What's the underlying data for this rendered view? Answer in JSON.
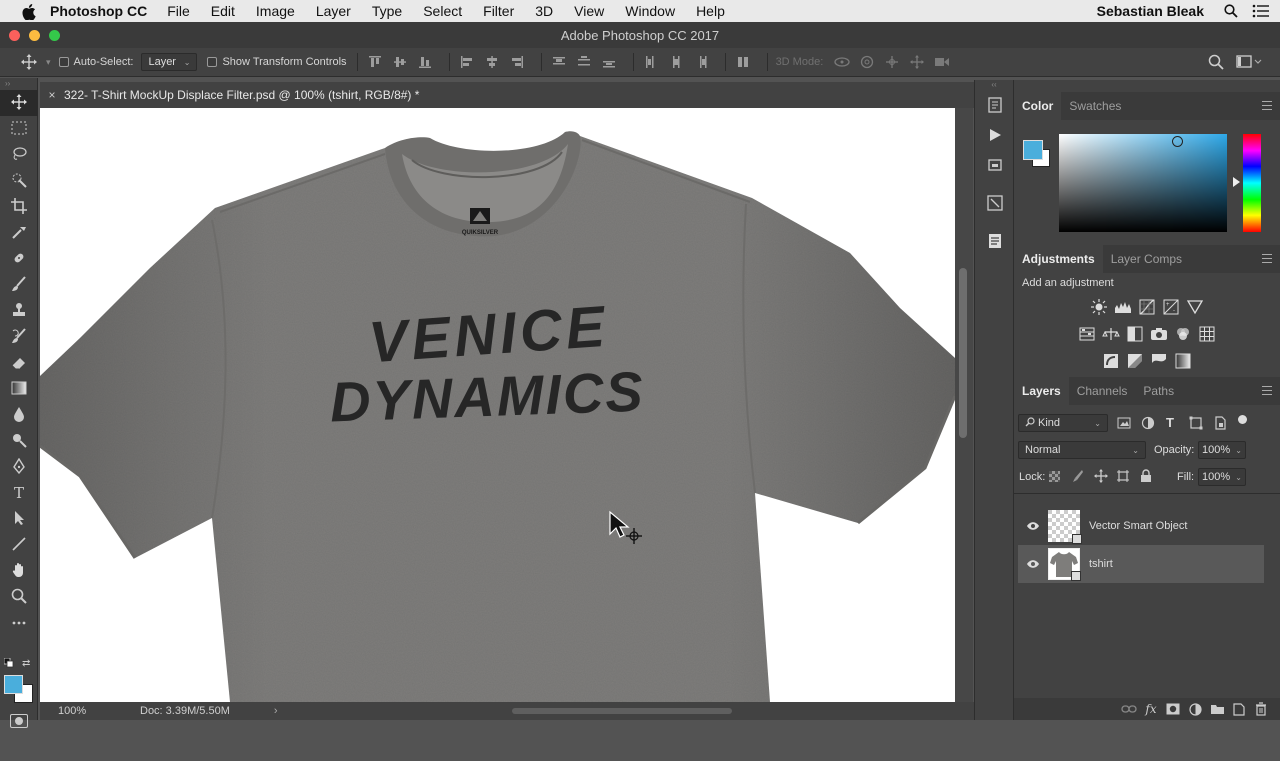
{
  "menubar": {
    "app_name": "Photoshop CC",
    "items": [
      "File",
      "Edit",
      "Image",
      "Layer",
      "Type",
      "Select",
      "Filter",
      "3D",
      "View",
      "Window",
      "Help"
    ],
    "user": "Sebastian Bleak",
    "icons": [
      "apple-icon",
      "search-icon",
      "list-menu-icon"
    ]
  },
  "window": {
    "title": "Adobe Photoshop CC 2017"
  },
  "options_bar": {
    "auto_select_label": "Auto-Select:",
    "auto_select_checked": false,
    "auto_select_target": "Layer",
    "show_transform_label": "Show Transform Controls",
    "show_transform_checked": false,
    "mode_3d_label": "3D Mode:"
  },
  "document": {
    "tab_title": "322- T-Shirt MockUp Displace Filter.psd @ 100% (tshirt, RGB/8#) *",
    "artwork_line1": "VENICE",
    "artwork_line2": "DYNAMICS",
    "label_brand": "QUIKSILVER",
    "zoom": "100%",
    "doc_size": "Doc: 3.39M/5.50M"
  },
  "tools": [
    "move-tool",
    "marquee-tool",
    "lasso-tool",
    "quick-select-tool",
    "crop-tool",
    "eyedropper-tool",
    "healing-tool",
    "brush-tool",
    "stamp-tool",
    "history-brush-tool",
    "eraser-tool",
    "gradient-tool",
    "blur-tool",
    "dodge-tool",
    "pen-tool",
    "type-tool",
    "path-select-tool",
    "line-tool",
    "hand-tool",
    "zoom-tool",
    "more-tools"
  ],
  "color_panel": {
    "tabs": [
      "Color",
      "Swatches"
    ],
    "active_tab": "Color",
    "foreground": "#4aaedc",
    "background": "#ffffff"
  },
  "adjustments_panel": {
    "tabs": [
      "Adjustments",
      "Layer Comps"
    ],
    "active_tab": "Adjustments",
    "add_label": "Add an adjustment"
  },
  "layers_panel": {
    "tabs": [
      "Layers",
      "Channels",
      "Paths"
    ],
    "active_tab": "Layers",
    "filter_kind": "Kind",
    "blend_mode": "Normal",
    "opacity_label": "Opacity:",
    "opacity_value": "100%",
    "lock_label": "Lock:",
    "fill_label": "Fill:",
    "fill_value": "100%",
    "layers": [
      {
        "name": "Vector Smart Object",
        "visible": true,
        "selected": false
      },
      {
        "name": "tshirt",
        "visible": true,
        "selected": true
      }
    ]
  }
}
